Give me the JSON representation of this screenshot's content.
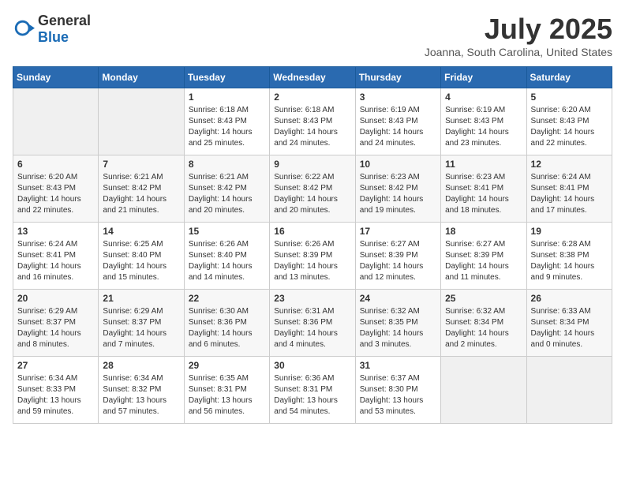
{
  "logo": {
    "text_general": "General",
    "text_blue": "Blue"
  },
  "title": "July 2025",
  "subtitle": "Joanna, South Carolina, United States",
  "days_of_week": [
    "Sunday",
    "Monday",
    "Tuesday",
    "Wednesday",
    "Thursday",
    "Friday",
    "Saturday"
  ],
  "weeks": [
    [
      {
        "day": "",
        "empty": true
      },
      {
        "day": "",
        "empty": true
      },
      {
        "day": "1",
        "sunrise": "Sunrise: 6:18 AM",
        "sunset": "Sunset: 8:43 PM",
        "daylight": "Daylight: 14 hours and 25 minutes."
      },
      {
        "day": "2",
        "sunrise": "Sunrise: 6:18 AM",
        "sunset": "Sunset: 8:43 PM",
        "daylight": "Daylight: 14 hours and 24 minutes."
      },
      {
        "day": "3",
        "sunrise": "Sunrise: 6:19 AM",
        "sunset": "Sunset: 8:43 PM",
        "daylight": "Daylight: 14 hours and 24 minutes."
      },
      {
        "day": "4",
        "sunrise": "Sunrise: 6:19 AM",
        "sunset": "Sunset: 8:43 PM",
        "daylight": "Daylight: 14 hours and 23 minutes."
      },
      {
        "day": "5",
        "sunrise": "Sunrise: 6:20 AM",
        "sunset": "Sunset: 8:43 PM",
        "daylight": "Daylight: 14 hours and 22 minutes."
      }
    ],
    [
      {
        "day": "6",
        "sunrise": "Sunrise: 6:20 AM",
        "sunset": "Sunset: 8:43 PM",
        "daylight": "Daylight: 14 hours and 22 minutes."
      },
      {
        "day": "7",
        "sunrise": "Sunrise: 6:21 AM",
        "sunset": "Sunset: 8:42 PM",
        "daylight": "Daylight: 14 hours and 21 minutes."
      },
      {
        "day": "8",
        "sunrise": "Sunrise: 6:21 AM",
        "sunset": "Sunset: 8:42 PM",
        "daylight": "Daylight: 14 hours and 20 minutes."
      },
      {
        "day": "9",
        "sunrise": "Sunrise: 6:22 AM",
        "sunset": "Sunset: 8:42 PM",
        "daylight": "Daylight: 14 hours and 20 minutes."
      },
      {
        "day": "10",
        "sunrise": "Sunrise: 6:23 AM",
        "sunset": "Sunset: 8:42 PM",
        "daylight": "Daylight: 14 hours and 19 minutes."
      },
      {
        "day": "11",
        "sunrise": "Sunrise: 6:23 AM",
        "sunset": "Sunset: 8:41 PM",
        "daylight": "Daylight: 14 hours and 18 minutes."
      },
      {
        "day": "12",
        "sunrise": "Sunrise: 6:24 AM",
        "sunset": "Sunset: 8:41 PM",
        "daylight": "Daylight: 14 hours and 17 minutes."
      }
    ],
    [
      {
        "day": "13",
        "sunrise": "Sunrise: 6:24 AM",
        "sunset": "Sunset: 8:41 PM",
        "daylight": "Daylight: 14 hours and 16 minutes."
      },
      {
        "day": "14",
        "sunrise": "Sunrise: 6:25 AM",
        "sunset": "Sunset: 8:40 PM",
        "daylight": "Daylight: 14 hours and 15 minutes."
      },
      {
        "day": "15",
        "sunrise": "Sunrise: 6:26 AM",
        "sunset": "Sunset: 8:40 PM",
        "daylight": "Daylight: 14 hours and 14 minutes."
      },
      {
        "day": "16",
        "sunrise": "Sunrise: 6:26 AM",
        "sunset": "Sunset: 8:39 PM",
        "daylight": "Daylight: 14 hours and 13 minutes."
      },
      {
        "day": "17",
        "sunrise": "Sunrise: 6:27 AM",
        "sunset": "Sunset: 8:39 PM",
        "daylight": "Daylight: 14 hours and 12 minutes."
      },
      {
        "day": "18",
        "sunrise": "Sunrise: 6:27 AM",
        "sunset": "Sunset: 8:39 PM",
        "daylight": "Daylight: 14 hours and 11 minutes."
      },
      {
        "day": "19",
        "sunrise": "Sunrise: 6:28 AM",
        "sunset": "Sunset: 8:38 PM",
        "daylight": "Daylight: 14 hours and 9 minutes."
      }
    ],
    [
      {
        "day": "20",
        "sunrise": "Sunrise: 6:29 AM",
        "sunset": "Sunset: 8:37 PM",
        "daylight": "Daylight: 14 hours and 8 minutes."
      },
      {
        "day": "21",
        "sunrise": "Sunrise: 6:29 AM",
        "sunset": "Sunset: 8:37 PM",
        "daylight": "Daylight: 14 hours and 7 minutes."
      },
      {
        "day": "22",
        "sunrise": "Sunrise: 6:30 AM",
        "sunset": "Sunset: 8:36 PM",
        "daylight": "Daylight: 14 hours and 6 minutes."
      },
      {
        "day": "23",
        "sunrise": "Sunrise: 6:31 AM",
        "sunset": "Sunset: 8:36 PM",
        "daylight": "Daylight: 14 hours and 4 minutes."
      },
      {
        "day": "24",
        "sunrise": "Sunrise: 6:32 AM",
        "sunset": "Sunset: 8:35 PM",
        "daylight": "Daylight: 14 hours and 3 minutes."
      },
      {
        "day": "25",
        "sunrise": "Sunrise: 6:32 AM",
        "sunset": "Sunset: 8:34 PM",
        "daylight": "Daylight: 14 hours and 2 minutes."
      },
      {
        "day": "26",
        "sunrise": "Sunrise: 6:33 AM",
        "sunset": "Sunset: 8:34 PM",
        "daylight": "Daylight: 14 hours and 0 minutes."
      }
    ],
    [
      {
        "day": "27",
        "sunrise": "Sunrise: 6:34 AM",
        "sunset": "Sunset: 8:33 PM",
        "daylight": "Daylight: 13 hours and 59 minutes."
      },
      {
        "day": "28",
        "sunrise": "Sunrise: 6:34 AM",
        "sunset": "Sunset: 8:32 PM",
        "daylight": "Daylight: 13 hours and 57 minutes."
      },
      {
        "day": "29",
        "sunrise": "Sunrise: 6:35 AM",
        "sunset": "Sunset: 8:31 PM",
        "daylight": "Daylight: 13 hours and 56 minutes."
      },
      {
        "day": "30",
        "sunrise": "Sunrise: 6:36 AM",
        "sunset": "Sunset: 8:31 PM",
        "daylight": "Daylight: 13 hours and 54 minutes."
      },
      {
        "day": "31",
        "sunrise": "Sunrise: 6:37 AM",
        "sunset": "Sunset: 8:30 PM",
        "daylight": "Daylight: 13 hours and 53 minutes."
      },
      {
        "day": "",
        "empty": true
      },
      {
        "day": "",
        "empty": true
      }
    ]
  ]
}
